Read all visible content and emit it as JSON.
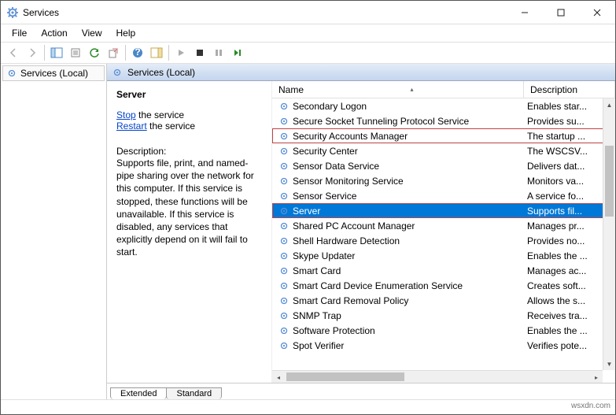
{
  "window": {
    "title": "Services"
  },
  "menu": {
    "file": "File",
    "action": "Action",
    "view": "View",
    "help": "Help"
  },
  "left": {
    "label": "Services (Local)"
  },
  "paneheader": "Services (Local)",
  "detail": {
    "title": "Server",
    "stop_link": "Stop",
    "stop_suffix": " the service",
    "restart_link": "Restart",
    "restart_suffix": " the service",
    "desc_label": "Description:",
    "desc": "Supports file, print, and named-pipe sharing over the network for this computer. If this service is stopped, these functions will be unavailable. If this service is disabled, any services that explicitly depend on it will fail to start."
  },
  "columns": {
    "name": "Name",
    "desc": "Description"
  },
  "tabs": {
    "extended": "Extended",
    "standard": "Standard"
  },
  "services": [
    {
      "name": "Secondary Logon",
      "desc": "Enables star..."
    },
    {
      "name": "Secure Socket Tunneling Protocol Service",
      "desc": "Provides su..."
    },
    {
      "name": "Security Accounts Manager",
      "desc": "The startup ...",
      "hl": true
    },
    {
      "name": "Security Center",
      "desc": "The WSCSV..."
    },
    {
      "name": "Sensor Data Service",
      "desc": "Delivers dat..."
    },
    {
      "name": "Sensor Monitoring Service",
      "desc": "Monitors va..."
    },
    {
      "name": "Sensor Service",
      "desc": "A service fo..."
    },
    {
      "name": "Server",
      "desc": "Supports fil...",
      "sel": true,
      "hl": true
    },
    {
      "name": "Shared PC Account Manager",
      "desc": "Manages pr..."
    },
    {
      "name": "Shell Hardware Detection",
      "desc": "Provides no..."
    },
    {
      "name": "Skype Updater",
      "desc": "Enables the ..."
    },
    {
      "name": "Smart Card",
      "desc": "Manages ac..."
    },
    {
      "name": "Smart Card Device Enumeration Service",
      "desc": "Creates soft..."
    },
    {
      "name": "Smart Card Removal Policy",
      "desc": "Allows the s..."
    },
    {
      "name": "SNMP Trap",
      "desc": "Receives tra..."
    },
    {
      "name": "Software Protection",
      "desc": "Enables the ..."
    },
    {
      "name": "Spot Verifier",
      "desc": "Verifies pote..."
    }
  ],
  "footer": "wsxdn.com"
}
